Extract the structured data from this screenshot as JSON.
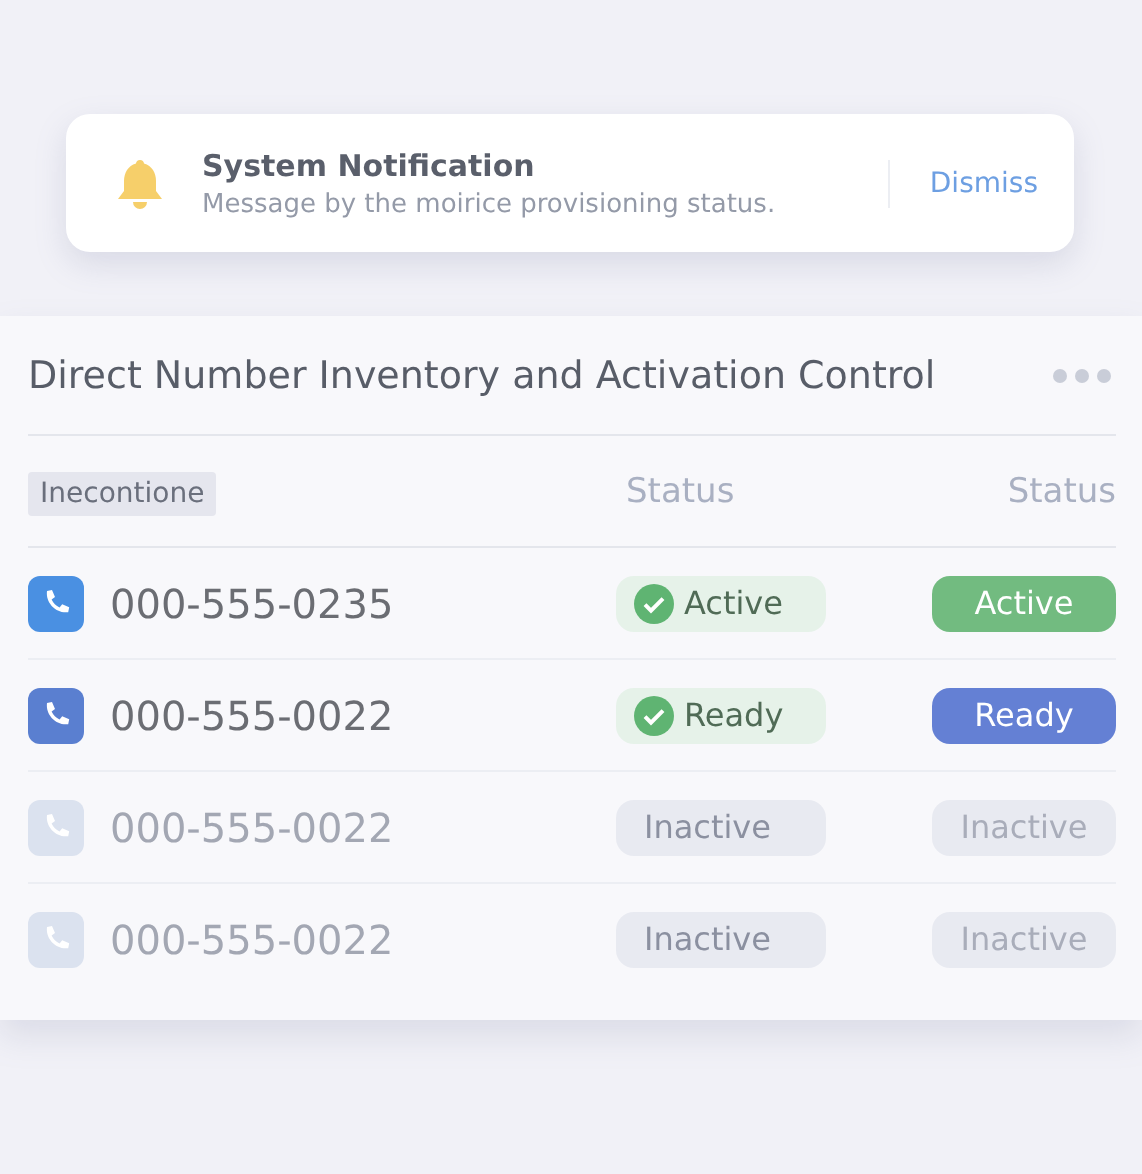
{
  "notification": {
    "title": "System Notification",
    "message": "Message by the moirice provisioning status.",
    "action": "Dismiss"
  },
  "panel": {
    "title": "Direct Number Inventory and Activation Control",
    "columns": [
      {
        "label": "Inecontione",
        "kind": "tag"
      },
      {
        "label": "Status",
        "kind": "plain"
      },
      {
        "label": "Status",
        "kind": "plain"
      }
    ],
    "rows": [
      {
        "number": "000-555-0235",
        "enabled": true,
        "color": "#4a90e2",
        "status": {
          "label": "Active",
          "kind": "check"
        },
        "badge": {
          "label": "Active",
          "color": "#72bb80"
        }
      },
      {
        "number": "000-555-0022",
        "enabled": true,
        "color": "#5a7fd0",
        "status": {
          "label": "Ready",
          "kind": "check"
        },
        "badge": {
          "label": "Ready",
          "color": "#6480d4"
        }
      },
      {
        "number": "000-555-0022",
        "enabled": false,
        "color": "#dbe2ef",
        "status": {
          "label": "Inactive",
          "kind": "plain"
        },
        "badge": {
          "label": "Inactive",
          "color": "#e8eaf1"
        }
      },
      {
        "number": "000-555-0022",
        "enabled": false,
        "color": "#dbe2ef",
        "status": {
          "label": "Inactive",
          "kind": "plain"
        },
        "badge": {
          "label": "Inactive",
          "color": "#e8eaf1"
        }
      }
    ]
  }
}
